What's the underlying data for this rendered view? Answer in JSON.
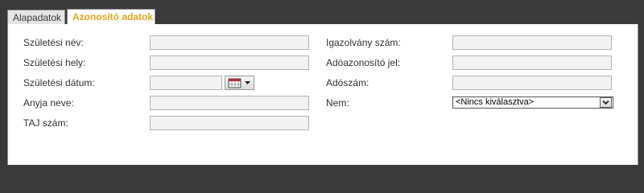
{
  "tabs": [
    {
      "label": "Alapadatok"
    },
    {
      "label": "Azonosító adatok"
    }
  ],
  "form": {
    "left": [
      {
        "label": "Születési név:",
        "value": ""
      },
      {
        "label": "Születési hely:",
        "value": ""
      },
      {
        "label": "Születési dátum:",
        "value": ""
      },
      {
        "label": "Anyja neve:",
        "value": ""
      },
      {
        "label": "TAJ szám:",
        "value": ""
      }
    ],
    "right": [
      {
        "label": "Igazolvány szám:",
        "value": ""
      },
      {
        "label": "Adóazonosító jel:",
        "value": ""
      },
      {
        "label": "Adószám:",
        "value": ""
      },
      {
        "label": "Nem:",
        "value": "<Nincs kiválasztva>"
      }
    ]
  },
  "icons": {
    "date_picker": "calendar-icon",
    "dropdown": "chevron-down-icon"
  }
}
